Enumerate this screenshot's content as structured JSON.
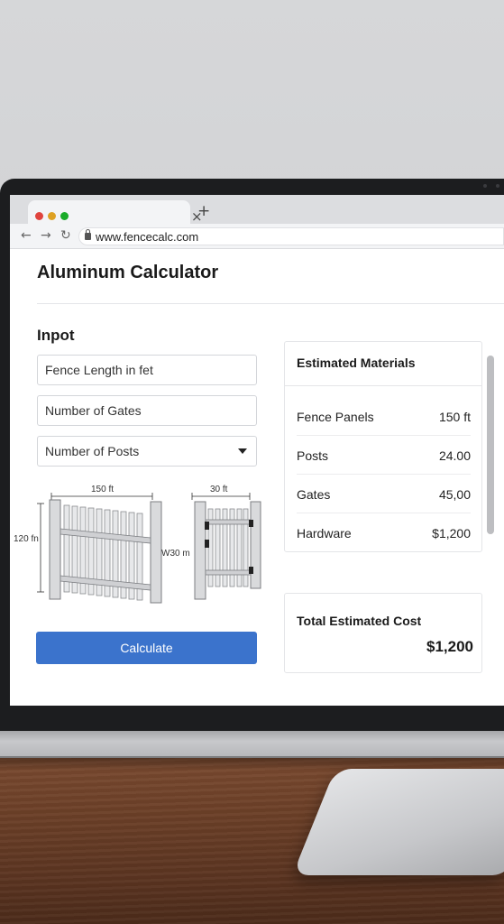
{
  "browser": {
    "url": "www.fencecalc.com",
    "tab_close_icon": "×",
    "new_tab_icon": "+",
    "back_icon": "←",
    "forward_icon": "→",
    "reload_icon": "↻",
    "traffic_lights": [
      "#e0443e",
      "#dea123",
      "#1aab29"
    ]
  },
  "page": {
    "title": "Aluminum Calculator"
  },
  "input": {
    "heading": "Inpot",
    "fence_length_placeholder": "Fence Length in fet",
    "gates_placeholder": "Number of Gates",
    "posts_select_label": "Number of Posts",
    "calculate_label": "Calculate"
  },
  "diagram": {
    "width_label": "150 ft",
    "height_label": "120 fn",
    "gate_width_label": "30 ft",
    "gate_height_label": "W30 m"
  },
  "materials": {
    "heading": "Estimated Materials",
    "rows": [
      {
        "label": "Fence Panels",
        "value": "150 ft"
      },
      {
        "label": "Posts",
        "value": "24.00"
      },
      {
        "label": "Gates",
        "value": "45,00"
      },
      {
        "label": "Hardware",
        "value": "$1,200"
      }
    ]
  },
  "total": {
    "label": "Total Estimated Cost",
    "value": "$1,200"
  },
  "colors": {
    "accent": "#3b73cc",
    "bezel": "#1c1d1f"
  }
}
